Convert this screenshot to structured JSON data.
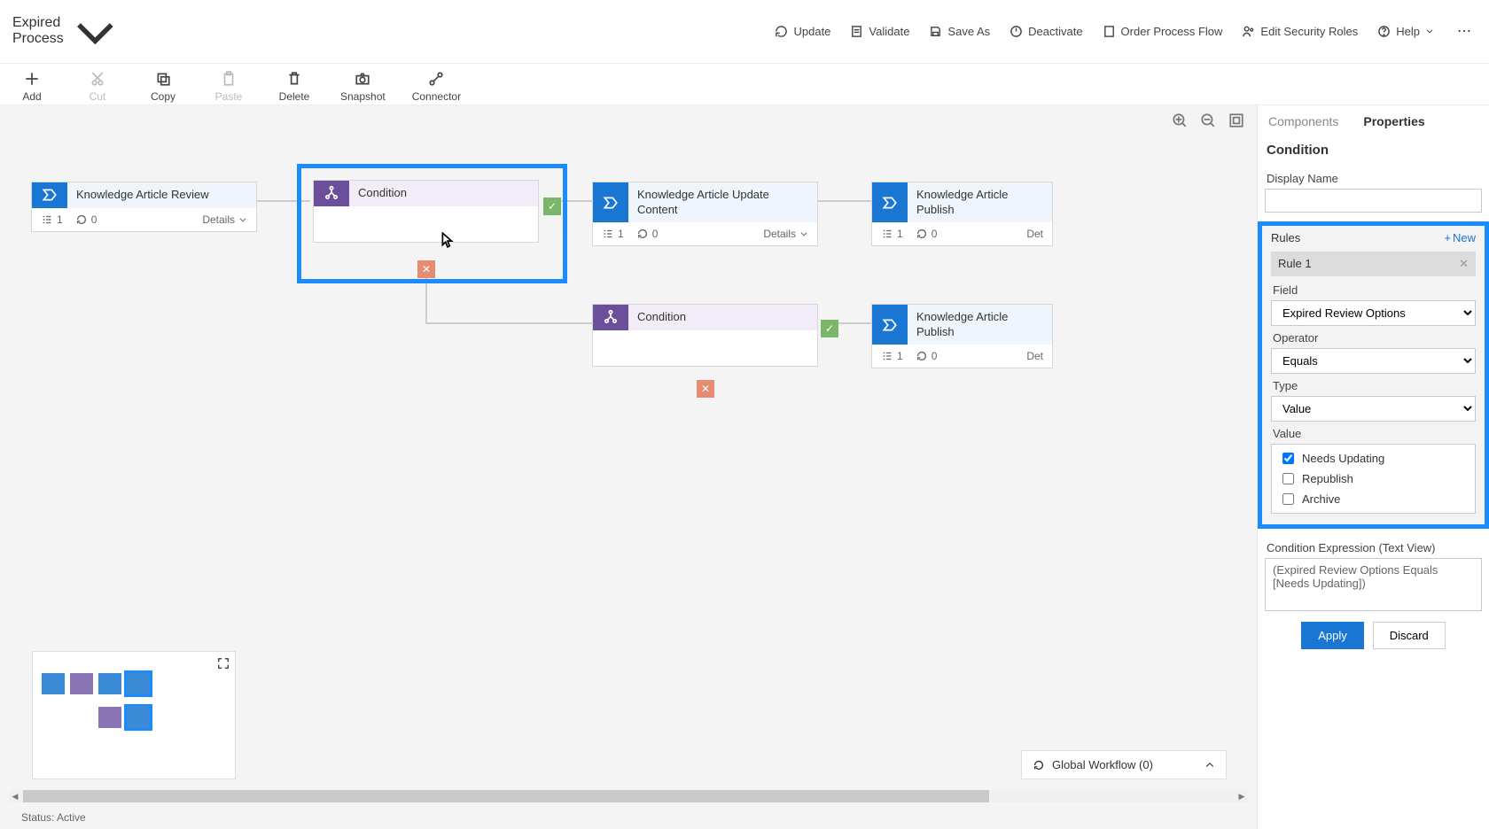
{
  "title": "Expired Process",
  "commands": {
    "update": "Update",
    "validate": "Validate",
    "saveas": "Save As",
    "deactivate": "Deactivate",
    "orderflow": "Order Process Flow",
    "security": "Edit Security Roles",
    "help": "Help"
  },
  "toolbar": {
    "add": "Add",
    "cut": "Cut",
    "copy": "Copy",
    "paste": "Paste",
    "delete": "Delete",
    "snapshot": "Snapshot",
    "connector": "Connector"
  },
  "stages": {
    "s1": {
      "title": "Knowledge Article Review",
      "steps": "1",
      "duration": "0",
      "details": "Details"
    },
    "s2": {
      "title": "Condition"
    },
    "s3": {
      "title": "Knowledge Article Update Content",
      "steps": "1",
      "duration": "0",
      "details": "Details"
    },
    "s4": {
      "title": "Knowledge Article Publish",
      "steps": "1",
      "duration": "0",
      "details": "Det"
    },
    "s5": {
      "title": "Condition"
    },
    "s6": {
      "title": "Knowledge Article Publish",
      "steps": "1",
      "duration": "0",
      "details": "Det"
    }
  },
  "globalwf": "Global Workflow (0)",
  "status": "Status: Active",
  "panel": {
    "tab_components": "Components",
    "tab_properties": "Properties",
    "section": "Condition",
    "display_name_label": "Display Name",
    "display_name_value": "",
    "rules_label": "Rules",
    "rules_new": "New",
    "rule1": "Rule 1",
    "field_label": "Field",
    "field_value": "Expired Review Options",
    "operator_label": "Operator",
    "operator_value": "Equals",
    "type_label": "Type",
    "type_value": "Value",
    "value_label": "Value",
    "value_opts": {
      "a": "Needs Updating",
      "b": "Republish",
      "c": "Archive"
    },
    "expr_label": "Condition Expression (Text View)",
    "expr_value": "(Expired Review Options Equals [Needs Updating])",
    "apply": "Apply",
    "discard": "Discard"
  }
}
